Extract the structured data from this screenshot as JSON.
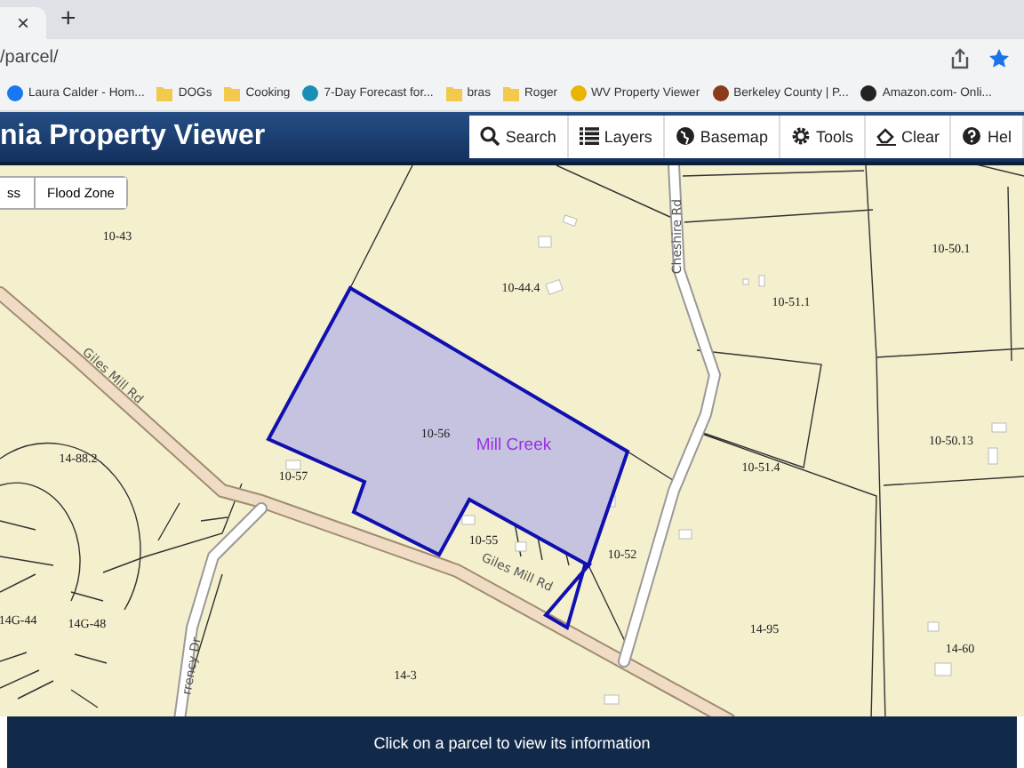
{
  "browser": {
    "tab_close": "×",
    "new_tab": "+",
    "address": "/parcel/"
  },
  "bookmarks": [
    {
      "kind": "site",
      "label": "Laura Calder - Hom..."
    },
    {
      "kind": "folder",
      "label": "DOGs"
    },
    {
      "kind": "folder",
      "label": "Cooking"
    },
    {
      "kind": "site",
      "label": "7-Day Forecast for..."
    },
    {
      "kind": "folder",
      "label": "bras"
    },
    {
      "kind": "folder",
      "label": "Roger"
    },
    {
      "kind": "site",
      "label": "WV Property Viewer"
    },
    {
      "kind": "site",
      "label": "Berkeley County | P..."
    },
    {
      "kind": "site",
      "label": "Amazon.com- Onli..."
    }
  ],
  "app": {
    "title": "nia Property Viewer"
  },
  "toolbar": [
    "Search",
    "Layers",
    "Basemap",
    "Tools",
    "Clear",
    "Hel"
  ],
  "map": {
    "layer_buttons": [
      "ss",
      "Flood Zone"
    ],
    "parcel_labels": [
      "10-43",
      "10-44.4",
      "10-51.1",
      "10-50.1",
      "10-56",
      "14-88.2",
      "10-57",
      "10-51.4",
      "10-50.13",
      "10-55",
      "10-52",
      "14G-44",
      "14G-48",
      "14-95",
      "14-60",
      "14-3"
    ],
    "road_labels": [
      "Cheshire Rd",
      "Giles Mill Rd",
      "Giles Mill Rd",
      "rrency Dr"
    ],
    "area_label": "Mill Creek"
  },
  "status_bar": "Click on a parcel to view its information"
}
